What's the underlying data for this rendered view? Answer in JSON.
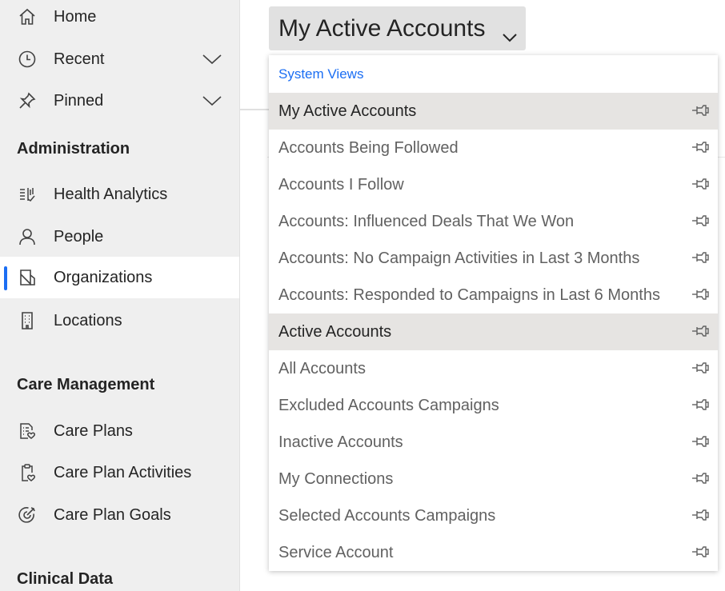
{
  "sidebar": {
    "items_top": [
      {
        "label": "Home",
        "icon": "home-icon"
      },
      {
        "label": "Recent",
        "icon": "clock-icon"
      },
      {
        "label": "Pinned",
        "icon": "pin-icon"
      }
    ],
    "sections": [
      {
        "title": "Administration",
        "items": [
          {
            "label": "Health Analytics",
            "icon": "health-analytics-icon"
          },
          {
            "label": "People",
            "icon": "person-icon"
          },
          {
            "label": "Organizations",
            "icon": "organization-icon",
            "selected": true
          },
          {
            "label": "Locations",
            "icon": "building-icon"
          }
        ]
      },
      {
        "title": "Care Management",
        "items": [
          {
            "label": "Care Plans",
            "icon": "care-plan-icon"
          },
          {
            "label": "Care Plan Activities",
            "icon": "clipboard-icon"
          },
          {
            "label": "Care Plan Goals",
            "icon": "target-icon"
          }
        ]
      },
      {
        "title": "Clinical Data",
        "items": []
      }
    ],
    "accent_color": "#1b6ef3"
  },
  "view_selector": {
    "label": "My Active Accounts"
  },
  "dropdown": {
    "header": "System Views",
    "items": [
      "My Active Accounts",
      "Accounts Being Followed",
      "Accounts I Follow",
      "Accounts: Influenced Deals That We Won",
      "Accounts: No Campaign Activities in Last 3 Months",
      "Accounts: Responded to Campaigns in Last 6 Months",
      "Active Accounts",
      "All Accounts",
      "Excluded Accounts Campaigns",
      "Inactive Accounts",
      "My Connections",
      "Selected Accounts Campaigns",
      "Service Account"
    ]
  }
}
